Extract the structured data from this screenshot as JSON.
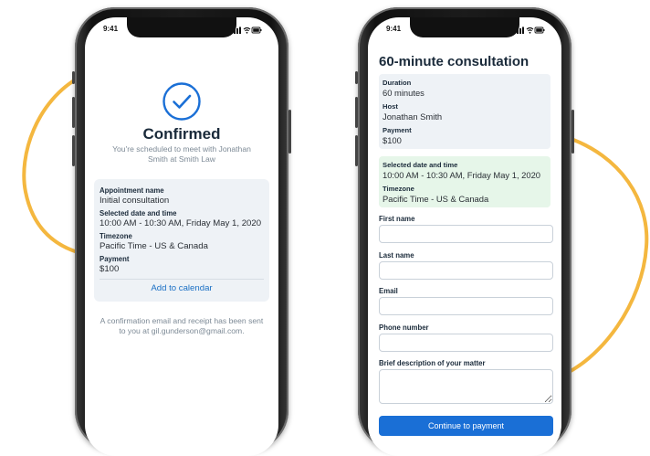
{
  "colors": {
    "accent": "#1a6fd6",
    "link": "#1a6fc4",
    "decor_ring": "#f4b73f",
    "confirm_blue": "#1a6fd6",
    "date_card_bg": "#e6f6e9",
    "info_card_bg": "#eef2f6"
  },
  "status_bar": {
    "time": "9:41",
    "icons": [
      "signal-icon",
      "wifi-icon",
      "battery-icon"
    ]
  },
  "confirmation": {
    "icon": "check-circle-icon",
    "title": "Confirmed",
    "subtitle": "You're scheduled to meet with Jonathan Smith at Smith Law",
    "details": [
      {
        "label": "Appointment name",
        "value": "Initial consultation"
      },
      {
        "label": "Selected date and time",
        "value": "10:00 AM - 10:30 AM, Friday May 1, 2020"
      },
      {
        "label": "Timezone",
        "value": "Pacific Time - US & Canada"
      },
      {
        "label": "Payment",
        "value": "$100"
      }
    ],
    "add_to_calendar": "Add to calendar",
    "footer": "A confirmation email and receipt has been sent to you at gil.gunderson@gmail.com."
  },
  "booking": {
    "title": "60-minute consultation",
    "summary": [
      {
        "label": "Duration",
        "value": "60 minutes"
      },
      {
        "label": "Host",
        "value": "Jonathan Smith"
      },
      {
        "label": "Payment",
        "value": "$100"
      }
    ],
    "schedule": [
      {
        "label": "Selected date and time",
        "value": "10:00 AM - 10:30 AM, Friday May 1, 2020"
      },
      {
        "label": "Timezone",
        "value": "Pacific Time - US & Canada"
      }
    ],
    "fields": [
      {
        "label": "First name",
        "value": "",
        "placeholder": ""
      },
      {
        "label": "Last name",
        "value": "",
        "placeholder": ""
      },
      {
        "label": "Email",
        "value": "",
        "placeholder": ""
      },
      {
        "label": "Phone number",
        "value": "",
        "placeholder": ""
      },
      {
        "label": "Brief description of your matter",
        "value": "",
        "placeholder": ""
      }
    ],
    "submit_label": "Continue to payment"
  }
}
